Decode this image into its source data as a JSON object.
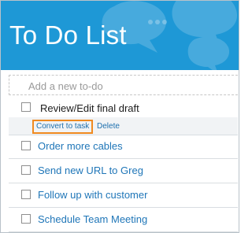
{
  "app": {
    "title": "To Do List"
  },
  "add_todo": {
    "placeholder": "Add a new to-do"
  },
  "selected_item": {
    "label": "Review/Edit final draft",
    "convert_label": "Convert to task",
    "delete_label": "Delete"
  },
  "tasks": [
    {
      "label": "Order more cables"
    },
    {
      "label": "Send new URL to Greg"
    },
    {
      "label": "Follow up with customer"
    },
    {
      "label": "Schedule Team Meeting"
    }
  ],
  "colors": {
    "header": "#1e98d6",
    "link": "#1f76b8",
    "highlight": "#f08a20"
  },
  "icons": {
    "header_decoration": "speech-bubbles-icon"
  }
}
